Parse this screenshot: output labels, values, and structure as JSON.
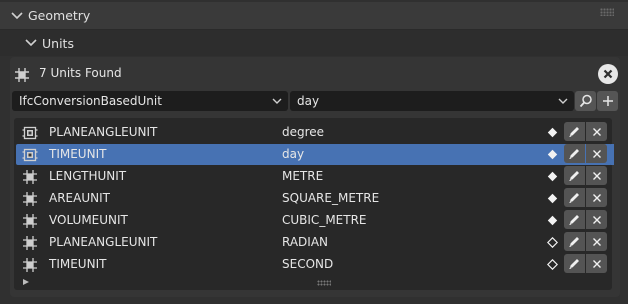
{
  "geometry_header": {
    "label": "Geometry"
  },
  "units_header": {
    "label": "Units"
  },
  "summary": {
    "text": "7 Units Found"
  },
  "filters": {
    "type_dropdown": "IfcConversionBasedUnit",
    "unit_dropdown": "day"
  },
  "units": [
    {
      "name": "PLANEANGLEUNIT",
      "value": "degree",
      "icon": "conversion-unit-icon",
      "marked": true
    },
    {
      "name": "TIMEUNIT",
      "value": "day",
      "icon": "conversion-unit-icon",
      "marked": true,
      "selected": true
    },
    {
      "name": "LENGTHUNIT",
      "value": "METRE",
      "icon": "si-unit-icon",
      "marked": true
    },
    {
      "name": "AREAUNIT",
      "value": "SQUARE_METRE",
      "icon": "si-unit-icon",
      "marked": true
    },
    {
      "name": "VOLUMEUNIT",
      "value": "CUBIC_METRE",
      "icon": "si-unit-icon",
      "marked": true
    },
    {
      "name": "PLANEANGLEUNIT",
      "value": "RADIAN",
      "icon": "si-unit-icon",
      "marked": false
    },
    {
      "name": "TIMEUNIT",
      "value": "SECOND",
      "icon": "si-unit-icon",
      "marked": false
    }
  ],
  "colors": {
    "selection": "#4772b3",
    "panel": "#353535",
    "list_bg": "#282828"
  }
}
